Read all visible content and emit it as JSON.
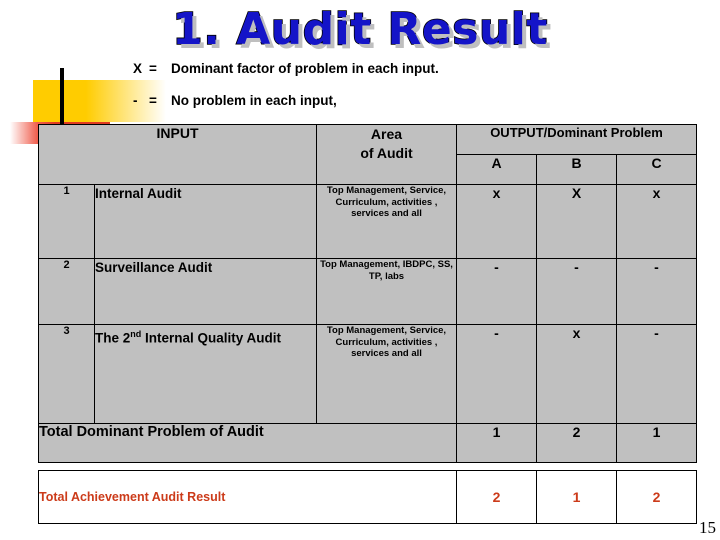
{
  "title": "1. Audit Result",
  "legend": [
    {
      "symbol": "X",
      "equals": "=",
      "text": "Dominant factor of problem in each input."
    },
    {
      "symbol": "-",
      "equals": "=",
      "text": "No problem in each  input,"
    }
  ],
  "table": {
    "headers": {
      "no": "",
      "input": "INPUT",
      "area_line1": "Area",
      "area_line2": "of Audit",
      "output_group": "OUTPUT/Dominant Problem",
      "col_a": "A",
      "col_b": "B",
      "col_c": "C"
    },
    "rows": [
      {
        "no": "1",
        "input": "Internal  Audit",
        "input_sup": "",
        "input_tail": "",
        "area": "Top Management, Service, Curriculum, activities , services and all",
        "a": "x",
        "b": "X",
        "c": "x"
      },
      {
        "no": "2",
        "input": "Surveillance Audit",
        "input_sup": "",
        "input_tail": "",
        "area": "Top Management, IBDPC, SS, TP, labs",
        "a": "-",
        "b": "-",
        "c": "-"
      },
      {
        "no": "3",
        "input": "The 2",
        "input_sup": "nd",
        "input_tail": "  Internal Quality Audit",
        "area": "Top Management, Service, Curriculum, activities , services and all",
        "a": "-",
        "b": "x",
        "c": "-"
      }
    ],
    "total_row": {
      "label": "Total Dominant Problem of Audit",
      "a": "1",
      "b": "2",
      "c": "1"
    }
  },
  "achievement_row": {
    "label": "Total Achievement Audit Result",
    "a": "2",
    "b": "1",
    "c": "2",
    "color": "#CC3B1A"
  },
  "page_number": "15",
  "colors": {
    "title_fill": "#1414C8",
    "title_outline": "#000000",
    "title_shadow": "#BFBFBF",
    "table_bg": "#C0C0C0",
    "accent_orange": "#CC3B1A",
    "ornament_yellow": "#FFCC00",
    "ornament_red": "#E03B22",
    "ornament_blue": "#000066"
  }
}
